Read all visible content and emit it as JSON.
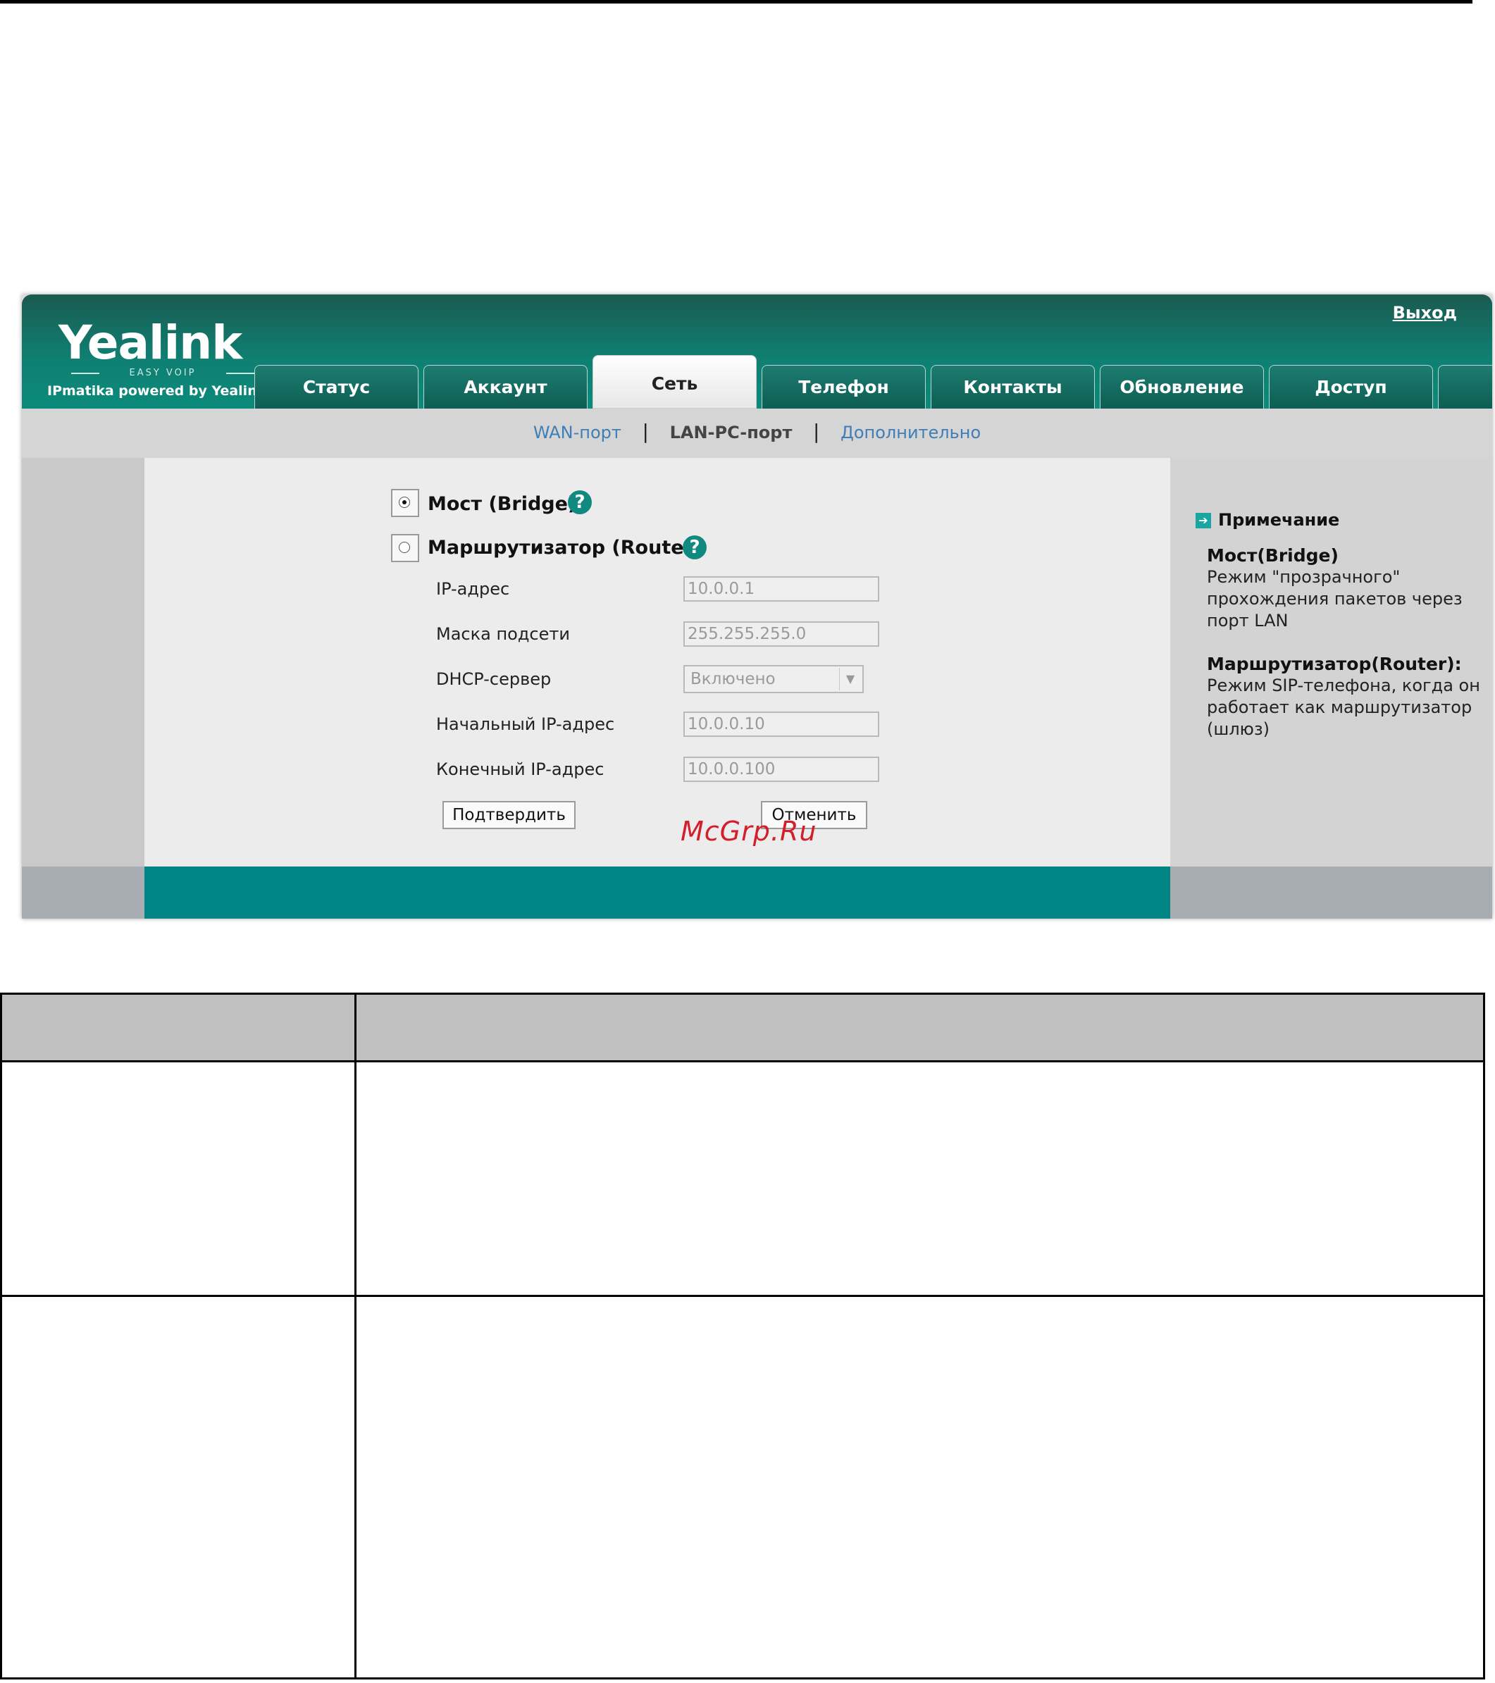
{
  "app": {
    "logo_text": "Yealink",
    "logo_subtext": "EASY VOIP",
    "logo_tagline": "IPmatika powered by Yealink",
    "logout_label": "Выход"
  },
  "tabs": [
    {
      "label": "Статус"
    },
    {
      "label": "Аккаунт"
    },
    {
      "label": "Сеть",
      "active": true
    },
    {
      "label": "Телефон"
    },
    {
      "label": "Контакты"
    },
    {
      "label": "Обновление"
    },
    {
      "label": "Доступ"
    }
  ],
  "subnav": {
    "wan": "WAN-порт",
    "lanpc": "LAN-PC-порт",
    "advanced": "Дополнительно"
  },
  "mode": {
    "bridge_label": "Мост (Bridge)",
    "bridge_selected": true,
    "router_label": "Маршрутизатор (Router)",
    "router_selected": false,
    "help_glyph": "?"
  },
  "form": {
    "ip_label": "IP-адрес",
    "ip_value": "10.0.0.1",
    "mask_label": "Маска подсети",
    "mask_value": "255.255.255.0",
    "dhcp_label": "DHCP-сервер",
    "dhcp_value": "Включено",
    "start_label": "Начальный IP-адрес",
    "start_value": "10.0.0.10",
    "end_label": "Конечный IP-адрес",
    "end_value": "10.0.0.100",
    "confirm_label": "Подтвердить",
    "cancel_label": "Отменить"
  },
  "watermark": "McGrp.Ru",
  "note": {
    "title": "Примечание",
    "bridge_head": "Мост(Bridge)",
    "bridge_text": "Режим \"прозрачного\" прохождения пакетов через порт LAN",
    "router_head": "Маршрутизатор(Router):",
    "router_text": "Режим SIP-телефона, когда он работает как маршрутизатор (шлюз)"
  },
  "colors": {
    "header_teal": "#0b8a7b",
    "footer_teal": "#008484",
    "link_blue": "#3f7eb6",
    "watermark_red": "#d21f2b"
  }
}
